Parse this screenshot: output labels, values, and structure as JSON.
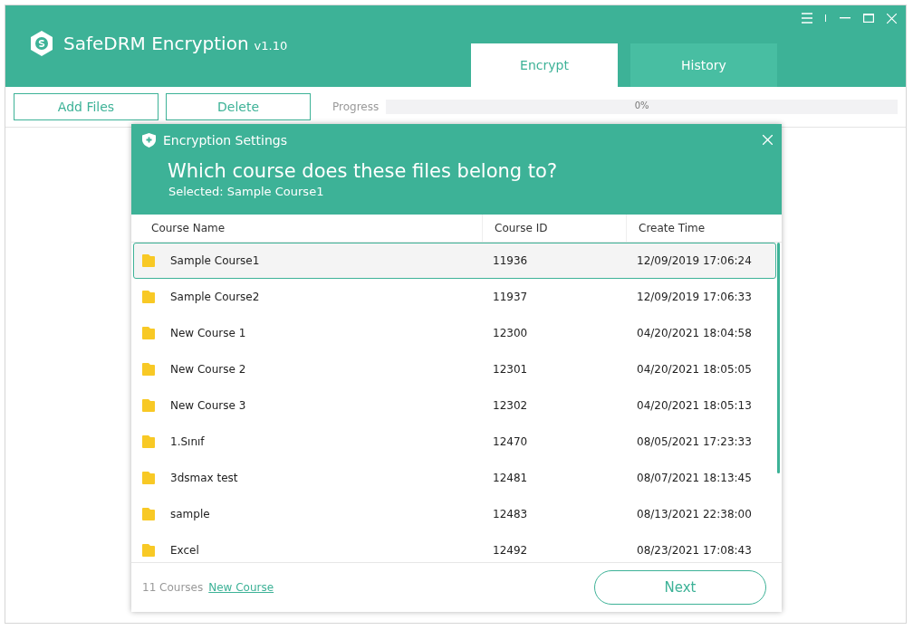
{
  "app": {
    "name": "SafeDRM Encryption",
    "version": "v1.10"
  },
  "tabs": [
    {
      "label": "Encrypt",
      "selected": true
    },
    {
      "label": "History",
      "selected": false
    }
  ],
  "toolbar": {
    "buttons": [
      "Add Files",
      "Delete"
    ],
    "progress": {
      "label": "Progress",
      "reading": "0%",
      "level": 0
    }
  },
  "dialog": {
    "title": "Encryption Settings",
    "question": "Which course does these files belong to?",
    "selected_text": "Selected: Sample Course1",
    "columns": [
      "Course Name",
      "Course ID",
      "Create Time"
    ],
    "rows": [
      {
        "name": "Sample Course1",
        "id": "11936",
        "time": "12/09/2019 17:06:24",
        "selected": true
      },
      {
        "name": "Sample Course2",
        "id": "11937",
        "time": "12/09/2019 17:06:33",
        "selected": false
      },
      {
        "name": "New Course 1",
        "id": "12300",
        "time": "04/20/2021 18:04:58",
        "selected": false
      },
      {
        "name": "New Course 2",
        "id": "12301",
        "time": "04/20/2021 18:05:05",
        "selected": false
      },
      {
        "name": "New Course 3",
        "id": "12302",
        "time": "04/20/2021 18:05:13",
        "selected": false
      },
      {
        "name": "1.Sınıf",
        "id": "12470",
        "time": "08/05/2021 17:23:33",
        "selected": false
      },
      {
        "name": "3dsmax test",
        "id": "12481",
        "time": "08/07/2021 18:13:45",
        "selected": false
      },
      {
        "name": "sample",
        "id": "12483",
        "time": "08/13/2021 22:38:00",
        "selected": false
      },
      {
        "name": "Excel",
        "id": "12492",
        "time": "08/23/2021 17:08:43",
        "selected": false
      }
    ],
    "count": "11 Courses",
    "new_course_link": "New Course",
    "next_button": "Next"
  }
}
